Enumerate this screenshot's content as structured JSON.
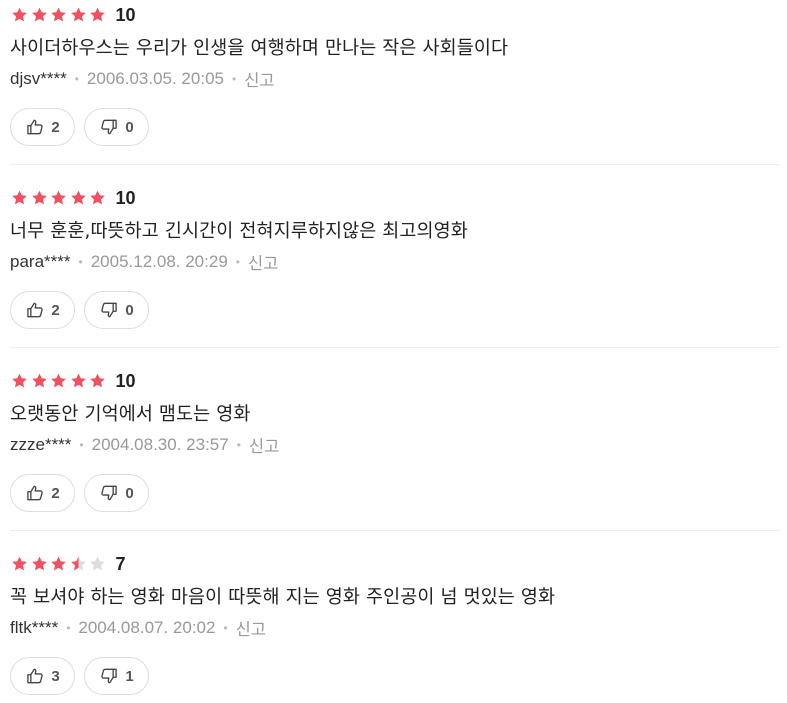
{
  "colors": {
    "star_on": "#f0505f",
    "star_off": "#dddddd",
    "meta": "#999999"
  },
  "reviews": [
    {
      "rating": 5,
      "score": "10",
      "comment": "사이더하우스는 우리가 인생을 여행하며 만나는 작은 사회들이다",
      "user": "djsv****",
      "date": "2006.03.05. 20:05",
      "report": "신고",
      "likes": "2",
      "dislikes": "0"
    },
    {
      "rating": 5,
      "score": "10",
      "comment": "너무 훈훈,따뜻하고 긴시간이 전혀지루하지않은 최고의영화",
      "user": "para****",
      "date": "2005.12.08. 20:29",
      "report": "신고",
      "likes": "2",
      "dislikes": "0"
    },
    {
      "rating": 5,
      "score": "10",
      "comment": "오랫동안 기억에서 맴도는 영화",
      "user": "zzze****",
      "date": "2004.08.30. 23:57",
      "report": "신고",
      "likes": "2",
      "dislikes": "0"
    },
    {
      "rating": 3.5,
      "score": "7",
      "comment": "꼭 보셔야 하는 영화 마음이 따뜻해 지는 영화 주인공이 넘 멋있는 영화",
      "user": "fltk****",
      "date": "2004.08.07. 20:02",
      "report": "신고",
      "likes": "3",
      "dislikes": "1"
    }
  ]
}
